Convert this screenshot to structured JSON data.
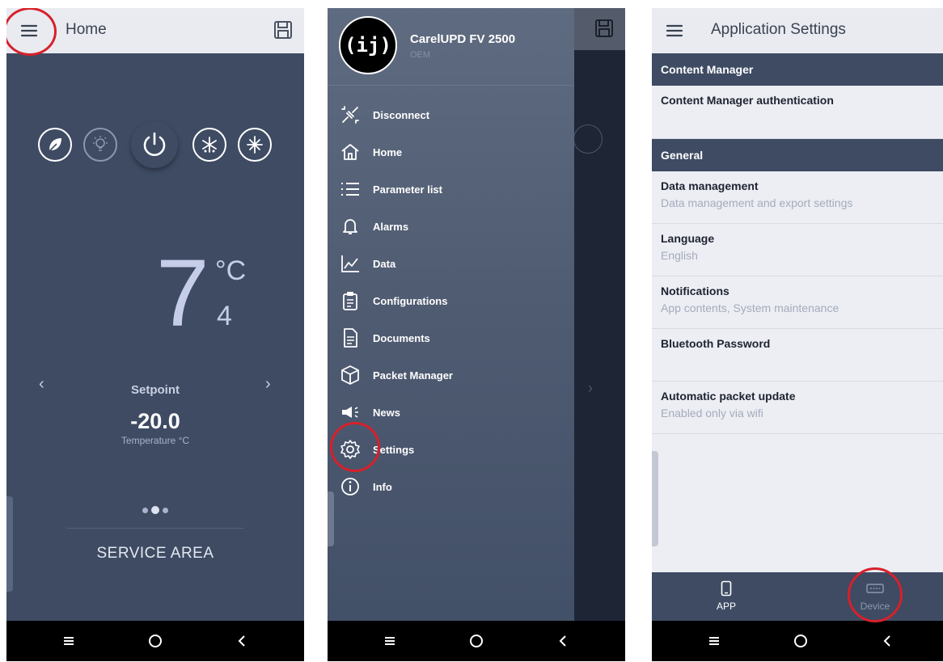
{
  "screen1": {
    "title": "Home",
    "temperature_main": "7",
    "temperature_unit": "°C",
    "temperature_decimal": "4",
    "setpoint_label": "Setpoint",
    "setpoint_value": "-20.0",
    "setpoint_sub": "Temperature °C",
    "service_label": "SERVICE AREA",
    "mode_icons": [
      "leaf-icon",
      "light-bulb-icon",
      "power-icon",
      "defrost-icon",
      "snowflake-icon"
    ],
    "pager": {
      "count": 3,
      "active": 2
    }
  },
  "screen2": {
    "device_name": "CarelUPD FV 2500",
    "device_sub": "OEM",
    "logo_text": "(ij)",
    "menu": [
      {
        "label": "Disconnect",
        "icon": "disconnect-icon"
      },
      {
        "label": "Home",
        "icon": "home-icon"
      },
      {
        "label": "Parameter list",
        "icon": "list-icon"
      },
      {
        "label": "Alarms",
        "icon": "bell-icon"
      },
      {
        "label": "Data",
        "icon": "chart-icon"
      },
      {
        "label": "Configurations",
        "icon": "clipboard-icon"
      },
      {
        "label": "Documents",
        "icon": "document-icon"
      },
      {
        "label": "Packet Manager",
        "icon": "package-icon"
      },
      {
        "label": "News",
        "icon": "megaphone-icon"
      },
      {
        "label": "Settings",
        "icon": "gear-icon"
      },
      {
        "label": "Info",
        "icon": "info-icon"
      }
    ]
  },
  "screen3": {
    "title": "Application Settings",
    "sections": [
      {
        "header": "Content Manager"
      },
      {
        "header": "General"
      }
    ],
    "items": {
      "cm_auth": {
        "title": "Content Manager authentication",
        "sub": ""
      },
      "data_mgmt": {
        "title": "Data management",
        "sub": "Data management and export settings"
      },
      "language": {
        "title": "Language",
        "sub": "English"
      },
      "notifications": {
        "title": "Notifications",
        "sub": "App contents, System maintenance"
      },
      "bt_password": {
        "title": "Bluetooth Password",
        "sub": ""
      },
      "auto_update": {
        "title": "Automatic packet update",
        "sub": "Enabled only via wifi"
      }
    },
    "tabs": [
      {
        "label": "APP",
        "icon": "phone-icon",
        "active": true
      },
      {
        "label": "Device",
        "icon": "device-icon",
        "active": false
      }
    ]
  },
  "colors": {
    "header_dark": "#3e4b63",
    "appbar_light": "#e9ebf1",
    "highlight": "#d8202a"
  }
}
